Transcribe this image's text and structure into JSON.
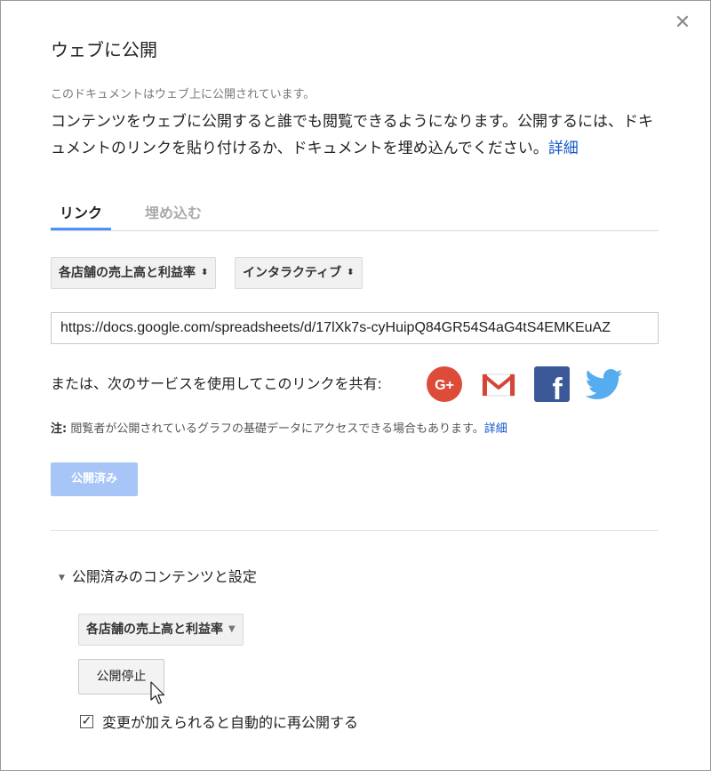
{
  "dialog": {
    "title": "ウェブに公開",
    "status": "このドキュメントはウェブ上に公開されています。",
    "description": "コンテンツをウェブに公開すると誰でも閲覧できるようになります。公開するには、ドキュメントのリンクを貼り付けるか、ドキュメントを埋め込んでください。",
    "details_link": "詳細",
    "close_symbol": "✕"
  },
  "tabs": [
    {
      "label": "リンク",
      "active": true
    },
    {
      "label": "埋め込む",
      "active": false
    }
  ],
  "link": {
    "sheet_select": "各店舗の売上高と利益率",
    "format_select": "インタラクティブ",
    "url": "https://docs.google.com/spreadsheets/d/17lXk7s-cyHuipQ84GR54S4aG4tS4EMKEuAZ"
  },
  "share": {
    "label": "または、次のサービスを使用してこのリンクを共有:",
    "services": [
      "google-plus",
      "gmail",
      "facebook",
      "twitter"
    ],
    "gplus_text": "G+",
    "facebook_text": "f"
  },
  "note": {
    "prefix": "注:",
    "text": "閲覧者が公開されているグラフの基礎データにアクセスできる場合もあります。",
    "link": "詳細"
  },
  "published_button": "公開済み",
  "settings": {
    "section_label": "公開済みのコンテンツと設定",
    "content_select": "各店舗の売上高と利益率",
    "stop_button": "公開停止",
    "auto_republish_label": "変更が加えられると自動的に再公開する",
    "auto_republish_checked": true
  },
  "colors": {
    "accent": "#4d90fe",
    "link": "#1155cc",
    "gplus": "#dd4b39",
    "facebook": "#3b5998",
    "twitter": "#55acee"
  }
}
